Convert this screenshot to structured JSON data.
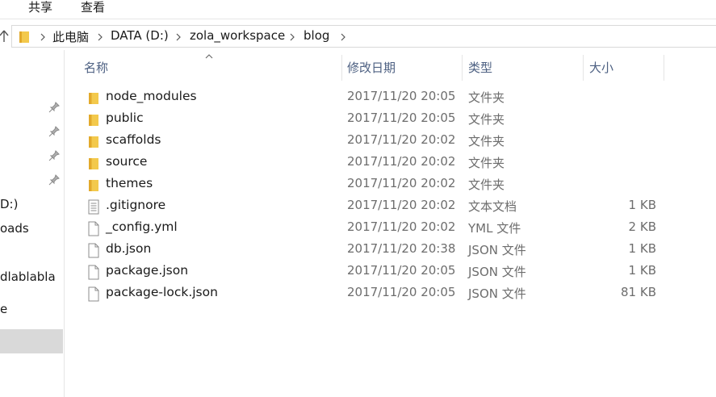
{
  "ribbon": {
    "tabs": [
      "共享",
      "查看"
    ]
  },
  "address": {
    "crumbs": [
      "此电脑",
      "DATA (D:)",
      "zola_workspace",
      "blog"
    ]
  },
  "nav": {
    "items": [
      "D:)",
      "oads",
      "dlablabla",
      "e"
    ]
  },
  "columns": {
    "name": "名称",
    "modified": "修改日期",
    "type": "类型",
    "size": "大小"
  },
  "files": [
    {
      "name": "node_modules",
      "date": "2017/11/20 20:05",
      "type": "文件夹",
      "size": "",
      "icon": "folder-icon"
    },
    {
      "name": "public",
      "date": "2017/11/20 20:05",
      "type": "文件夹",
      "size": "",
      "icon": "folder-icon"
    },
    {
      "name": "scaffolds",
      "date": "2017/11/20 20:02",
      "type": "文件夹",
      "size": "",
      "icon": "folder-icon"
    },
    {
      "name": "source",
      "date": "2017/11/20 20:02",
      "type": "文件夹",
      "size": "",
      "icon": "folder-icon"
    },
    {
      "name": "themes",
      "date": "2017/11/20 20:02",
      "type": "文件夹",
      "size": "",
      "icon": "folder-icon"
    },
    {
      "name": ".gitignore",
      "date": "2017/11/20 20:02",
      "type": "文本文档",
      "size": "1 KB",
      "icon": "text-file-icon"
    },
    {
      "name": "_config.yml",
      "date": "2017/11/20 20:02",
      "type": "YML 文件",
      "size": "2 KB",
      "icon": "file-icon"
    },
    {
      "name": "db.json",
      "date": "2017/11/20 20:38",
      "type": "JSON 文件",
      "size": "1 KB",
      "icon": "file-icon"
    },
    {
      "name": "package.json",
      "date": "2017/11/20 20:05",
      "type": "JSON 文件",
      "size": "1 KB",
      "icon": "file-icon"
    },
    {
      "name": "package-lock.json",
      "date": "2017/11/20 20:05",
      "type": "JSON 文件",
      "size": "81 KB",
      "icon": "file-icon"
    }
  ],
  "colors": {
    "folder": "#f3c94c",
    "folder_dark": "#e2a92b",
    "header_text": "#4d6082",
    "meta_text": "#6d6d6d",
    "selection": "#d9d9d9"
  }
}
